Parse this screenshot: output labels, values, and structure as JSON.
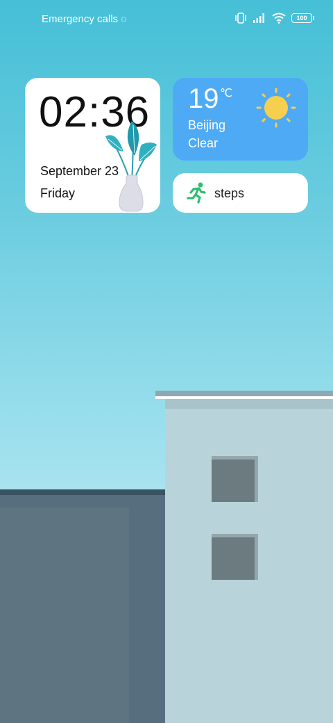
{
  "status_bar": {
    "emergency_text": "Emergency calls",
    "emergency_tail": "o",
    "battery_level": "100"
  },
  "clock_widget": {
    "time": "02:36",
    "date": "September 23",
    "day": "Friday"
  },
  "weather_widget": {
    "temperature": "19",
    "unit": "℃",
    "city": "Beijing",
    "condition": "Clear"
  },
  "steps_widget": {
    "label": "steps"
  },
  "colors": {
    "sky_top": "#45bfd7",
    "weather_bg": "#4faaf5",
    "runner": "#2fbf71",
    "sun": "#f7cf4e"
  },
  "icons": [
    "vibrate-icon",
    "signal-icon",
    "wifi-icon",
    "battery-icon",
    "sun-icon",
    "runner-icon",
    "plant-vase-icon"
  ]
}
